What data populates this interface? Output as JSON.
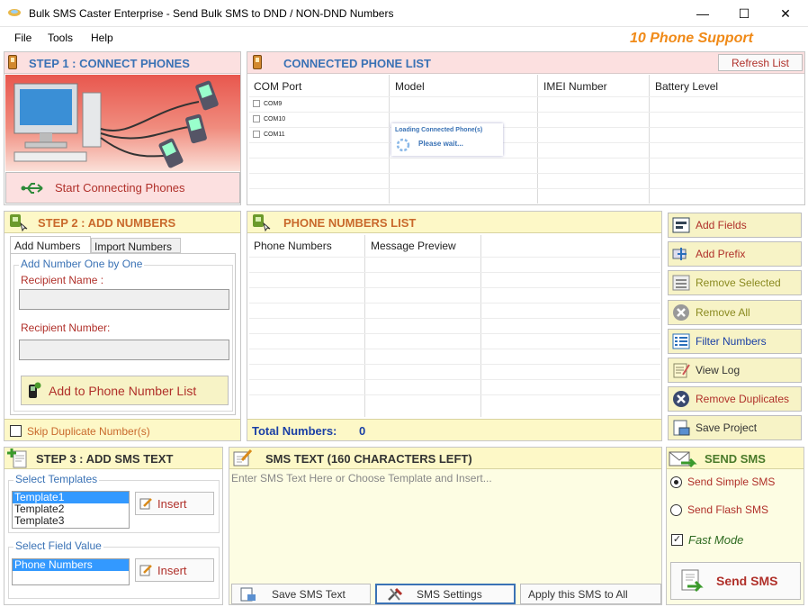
{
  "window": {
    "title": "Bulk SMS Caster Enterprise - Send Bulk SMS to DND / NON-DND Numbers",
    "minimize": "—",
    "maximize": "☐",
    "close": "✕"
  },
  "menu": {
    "items": [
      "File",
      "Tools",
      "Help"
    ],
    "support": "10 Phone Support"
  },
  "step1": {
    "title": "STEP 1 : CONNECT PHONES",
    "button": "Start Connecting Phones"
  },
  "connected": {
    "title": "CONNECTED PHONE LIST",
    "refresh": "Refresh List",
    "columns": [
      "COM  Port",
      "Model",
      "IMEI Number",
      "Battery Level"
    ],
    "ports": [
      "COM9",
      "COM10",
      "COM11"
    ],
    "loading_title": "Loading Connected Phone(s)",
    "loading_text": "Please wait..."
  },
  "step2": {
    "title": "STEP 2 : ADD NUMBERS",
    "tabs": [
      "Add Numbers",
      "Import Numbers"
    ],
    "group_title": "Add Number One by One",
    "recipient_name_label": "Recipient Name :",
    "recipient_number_label": "Recipient Number:",
    "add_button": "Add to Phone Number List",
    "skip_duplicates": "Skip Duplicate Number(s)"
  },
  "phone_list": {
    "title": "PHONE NUMBERS LIST",
    "columns": [
      "Phone Numbers",
      "Message Preview"
    ],
    "total_label": "Total Numbers:",
    "total_value": "0"
  },
  "side_buttons": [
    "Add Fields",
    "Add Prefix",
    "Remove Selected",
    "Remove All",
    "Filter Numbers",
    "View Log",
    "Remove Duplicates",
    "Save Project"
  ],
  "step3": {
    "title": "STEP 3 : ADD SMS TEXT",
    "templates_label": "Select Templates",
    "templates": [
      "Template1",
      "Template2",
      "Template3"
    ],
    "field_label": "Select Field Value",
    "fields": [
      "Phone Numbers"
    ],
    "insert": "Insert"
  },
  "sms_text": {
    "title": "SMS TEXT (160 CHARACTERS LEFT)",
    "placeholder": "Enter SMS Text Here or Choose Template and Insert...",
    "save": "Save SMS Text",
    "settings": "SMS Settings",
    "apply": "Apply this SMS to All"
  },
  "send": {
    "title": "SEND SMS",
    "simple": "Send Simple SMS",
    "flash": "Send Flash SMS",
    "fast_mode": "Fast Mode",
    "button": "Send SMS"
  },
  "colors": {
    "accent_blue": "#3a72b5",
    "accent_orange": "#f08a18",
    "header_pink": "#fce0e0",
    "header_yellow": "#fdf8c7"
  }
}
